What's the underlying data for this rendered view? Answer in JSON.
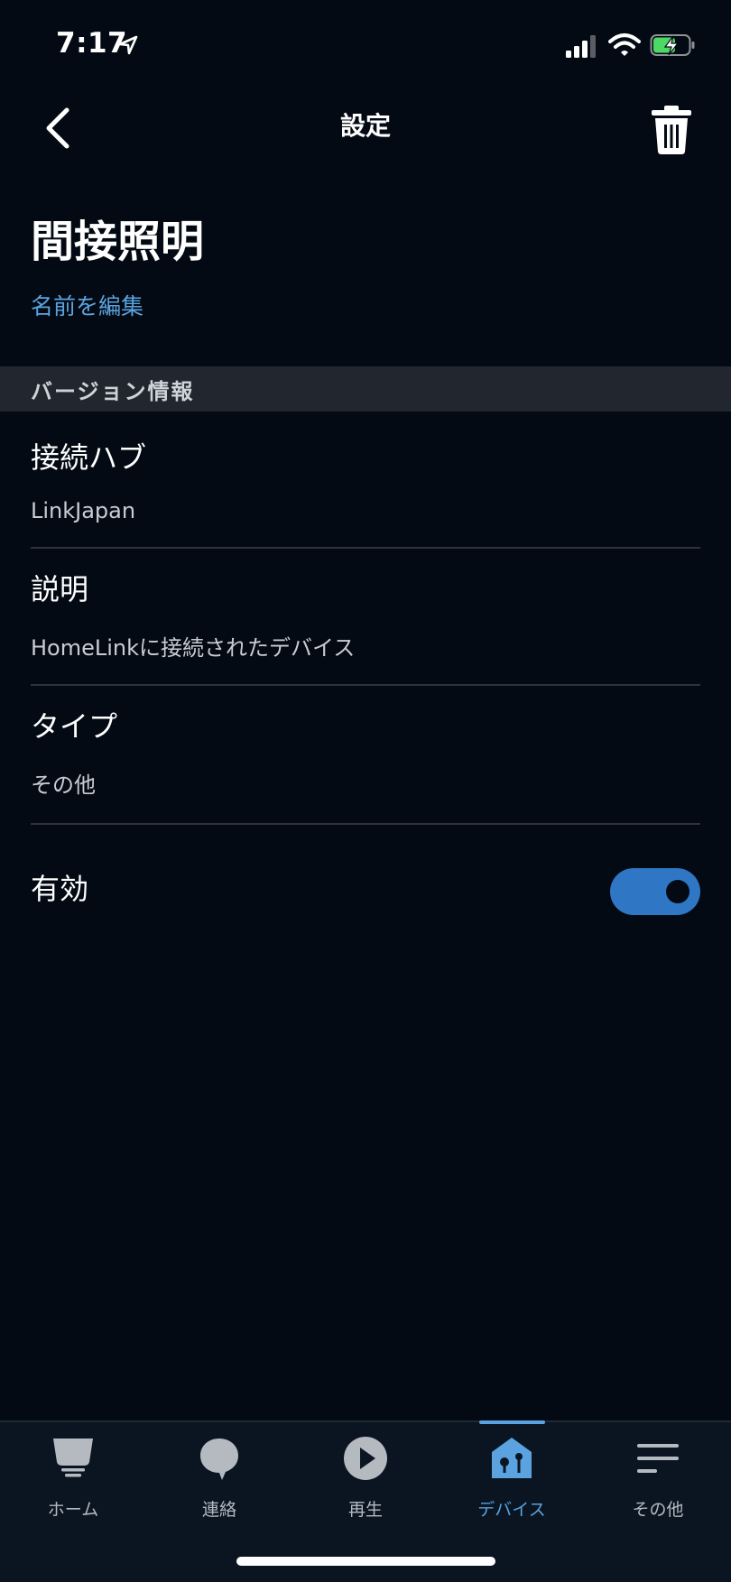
{
  "status_bar": {
    "time": "7:17"
  },
  "nav": {
    "title": "設定"
  },
  "device": {
    "name": "間接照明",
    "edit_name_label": "名前を編集"
  },
  "section": {
    "version_info_label": "バージョン情報"
  },
  "info_rows": [
    {
      "label": "接続ハブ",
      "value": "LinkJapan"
    },
    {
      "label": "説明",
      "value": "HomeLinkに接続されたデバイス"
    },
    {
      "label": "タイプ",
      "value": "その他"
    }
  ],
  "enabled": {
    "label": "有効",
    "on": true
  },
  "tabs": [
    {
      "label": "ホーム",
      "icon": "home-icon"
    },
    {
      "label": "連絡",
      "icon": "chat-bubble-icon"
    },
    {
      "label": "再生",
      "icon": "play-icon"
    },
    {
      "label": "デバイス",
      "icon": "devices-icon",
      "active": true
    },
    {
      "label": "その他",
      "icon": "menu-icon"
    }
  ],
  "colors": {
    "background": "#030a13",
    "accent": "#5aa3e0",
    "toggle_on": "#2f77c4",
    "section_header": "#22272f"
  }
}
